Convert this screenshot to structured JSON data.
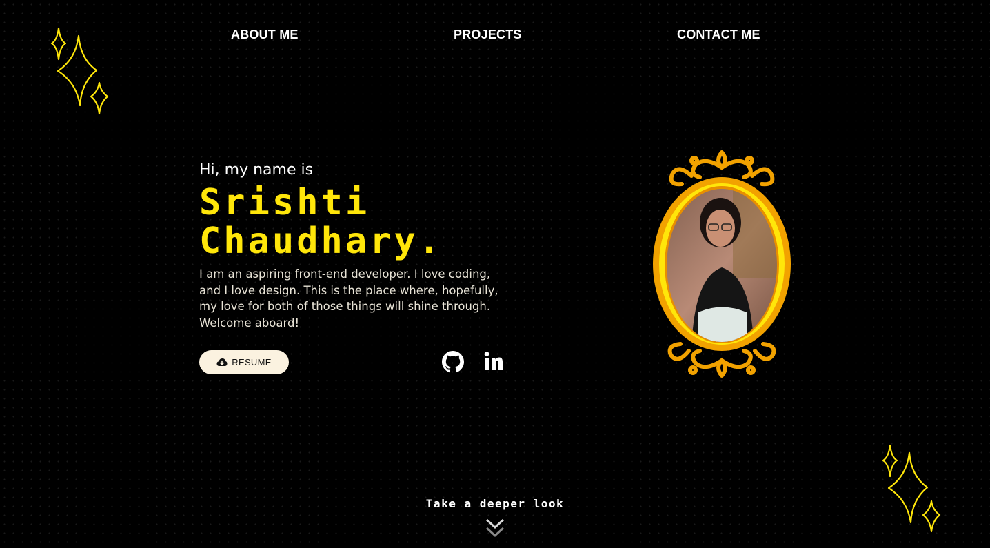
{
  "nav": {
    "about": "ABOUT ME",
    "projects": "PROJECTS",
    "contact": "CONTACT ME"
  },
  "hero": {
    "greeting": "Hi, my name is",
    "name_line1": "Srishti",
    "name_line2": "Chaudhary.",
    "bio": "I am an aspiring front-end developer. I love coding, and I love design. This is the place where, hopefully, my love for both of those things will shine through. Welcome aboard!",
    "resume_label": "RESUME"
  },
  "icons": {
    "resume": "cloud-download-icon",
    "github": "github-icon",
    "linkedin": "linkedin-icon",
    "scroll": "double-chevron-down-icon",
    "sparkles": "sparkle-icon"
  },
  "footer": {
    "cta": "Take a deeper look"
  },
  "colors": {
    "background": "#000000",
    "accent": "#ffe60a",
    "frame_orange": "#f2a200",
    "button_bg": "#fbf2e0"
  }
}
